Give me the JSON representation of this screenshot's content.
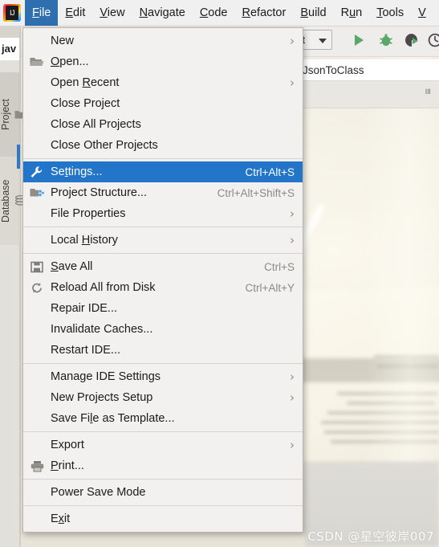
{
  "app": {
    "logo_icon": "intellij-idea-logo",
    "watermark": "CSDN @星空彼岸007"
  },
  "menubar": {
    "items": [
      {
        "label": "File",
        "mnemonic": "F",
        "active": true
      },
      {
        "label": "Edit",
        "mnemonic": "E",
        "active": false
      },
      {
        "label": "View",
        "mnemonic": "V",
        "active": false
      },
      {
        "label": "Navigate",
        "mnemonic": "N",
        "active": false
      },
      {
        "label": "Code",
        "mnemonic": "C",
        "active": false
      },
      {
        "label": "Refactor",
        "mnemonic": "R",
        "active": false
      },
      {
        "label": "Build",
        "mnemonic": "B",
        "active": false
      },
      {
        "label": "Run",
        "mnemonic": "u",
        "active": false
      },
      {
        "label": "Tools",
        "mnemonic": "T",
        "active": false
      },
      {
        "label": "V",
        "mnemonic": "V",
        "active": false
      }
    ]
  },
  "toolbar": {
    "run_config": "st",
    "run_icon": "run-play-icon",
    "debug_icon": "debug-bug-icon",
    "coverage_icon": "run-with-coverage-icon",
    "profiler_icon": "profiler-icon",
    "open_folder_icon": "folder-open-icon"
  },
  "editor": {
    "tab_label": "JsonToClass",
    "file_tab_label": "jav"
  },
  "left_stripe": {
    "project_label": "Project",
    "project_icon": "folder-icon",
    "database_label": "Database",
    "database_icon": "database-icon"
  },
  "file_menu": {
    "groups": [
      {
        "items": [
          {
            "label": "New",
            "icon": null,
            "accel": null,
            "submenu": true,
            "selected": false
          },
          {
            "label": "Open...",
            "icon": "folder-open-icon",
            "accel": null,
            "submenu": false,
            "selected": false,
            "mnemonic": "O"
          },
          {
            "label": "Open Recent",
            "icon": null,
            "accel": null,
            "submenu": true,
            "selected": false,
            "mnemonic": "R"
          },
          {
            "label": "Close Project",
            "icon": null,
            "accel": null,
            "submenu": false,
            "selected": false
          },
          {
            "label": "Close All Projects",
            "icon": null,
            "accel": null,
            "submenu": false,
            "selected": false
          },
          {
            "label": "Close Other Projects",
            "icon": null,
            "accel": null,
            "submenu": false,
            "selected": false
          }
        ]
      },
      {
        "items": [
          {
            "label": "Settings...",
            "icon": "wrench-icon",
            "accel": "Ctrl+Alt+S",
            "submenu": false,
            "selected": true,
            "mnemonic": "t"
          },
          {
            "label": "Project Structure...",
            "icon": "project-structure-icon",
            "accel": "Ctrl+Alt+Shift+S",
            "submenu": false,
            "selected": false
          },
          {
            "label": "File Properties",
            "icon": null,
            "accel": null,
            "submenu": true,
            "selected": false
          }
        ]
      },
      {
        "items": [
          {
            "label": "Local History",
            "icon": null,
            "accel": null,
            "submenu": true,
            "selected": false,
            "mnemonic": "H"
          }
        ]
      },
      {
        "items": [
          {
            "label": "Save All",
            "icon": "floppy-save-icon",
            "accel": "Ctrl+S",
            "submenu": false,
            "selected": false,
            "mnemonic": "S"
          },
          {
            "label": "Reload All from Disk",
            "icon": "refresh-icon",
            "accel": "Ctrl+Alt+Y",
            "submenu": false,
            "selected": false
          },
          {
            "label": "Repair IDE...",
            "icon": null,
            "accel": null,
            "submenu": false,
            "selected": false
          },
          {
            "label": "Invalidate Caches...",
            "icon": null,
            "accel": null,
            "submenu": false,
            "selected": false
          },
          {
            "label": "Restart IDE...",
            "icon": null,
            "accel": null,
            "submenu": false,
            "selected": false
          }
        ]
      },
      {
        "items": [
          {
            "label": "Manage IDE Settings",
            "icon": null,
            "accel": null,
            "submenu": true,
            "selected": false
          },
          {
            "label": "New Projects Setup",
            "icon": null,
            "accel": null,
            "submenu": true,
            "selected": false
          },
          {
            "label": "Save File as Template...",
            "icon": null,
            "accel": null,
            "submenu": false,
            "selected": false,
            "mnemonic": "l"
          }
        ]
      },
      {
        "items": [
          {
            "label": "Export",
            "icon": null,
            "accel": null,
            "submenu": true,
            "selected": false
          },
          {
            "label": "Print...",
            "icon": "printer-icon",
            "accel": null,
            "submenu": false,
            "selected": false,
            "mnemonic": "P"
          }
        ]
      },
      {
        "items": [
          {
            "label": "Power Save Mode",
            "icon": null,
            "accel": null,
            "submenu": false,
            "selected": false
          }
        ]
      },
      {
        "items": [
          {
            "label": "Exit",
            "icon": null,
            "accel": null,
            "submenu": false,
            "selected": false,
            "mnemonic": "x"
          }
        ]
      }
    ]
  },
  "colors": {
    "selection_blue": "#2275c9",
    "menubar_active_blue": "#2f6fb0",
    "menu_bg": "#f2f1ef",
    "accel_gray": "#8a8a8a",
    "run_green": "#59a869"
  }
}
